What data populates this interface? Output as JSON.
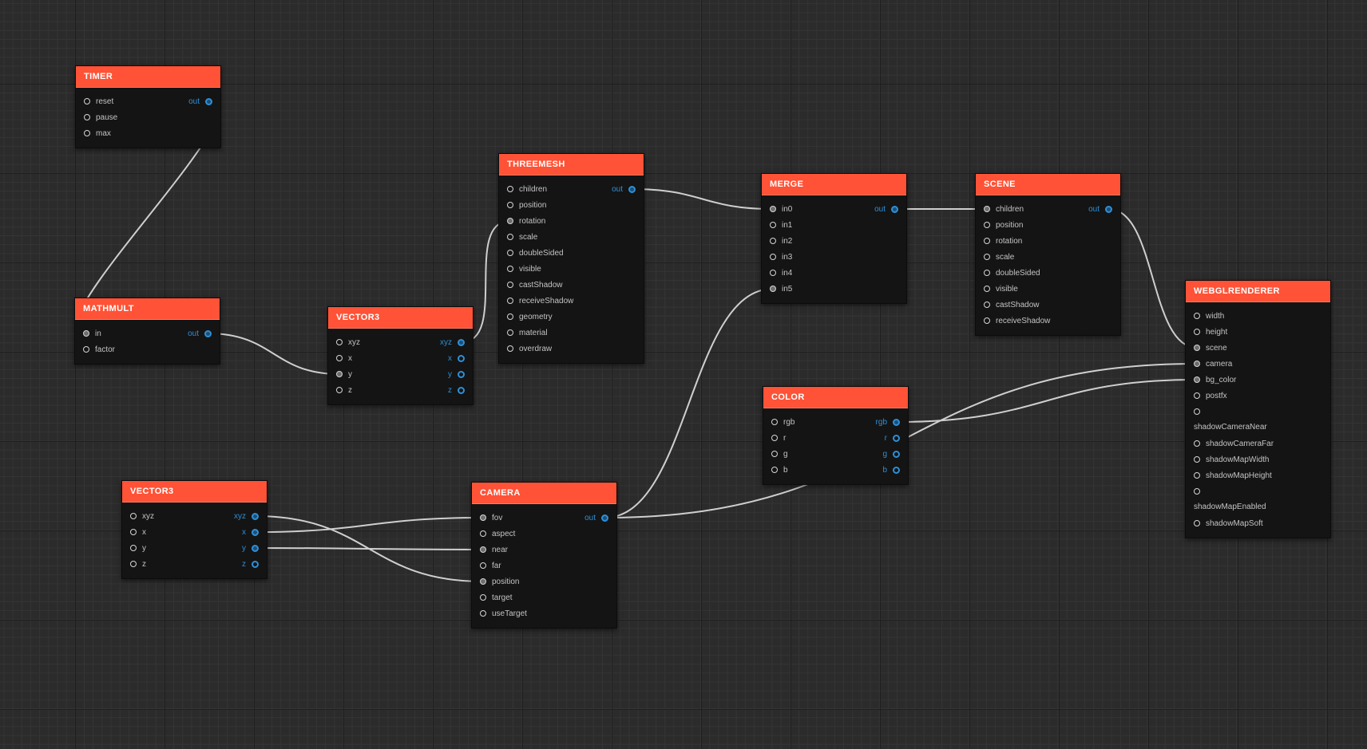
{
  "nodes": {
    "timer": {
      "title": "TIMER",
      "inputs": [
        "reset",
        "pause",
        "max"
      ],
      "outputs": [
        "out"
      ]
    },
    "mathmult": {
      "title": "MATHMULT",
      "inputs": [
        "in",
        "factor"
      ],
      "outputs": [
        "out"
      ]
    },
    "vector3_a": {
      "title": "VECTOR3",
      "inputs": [
        "xyz",
        "x",
        "y",
        "z"
      ],
      "outputs": [
        "xyz",
        "x",
        "y",
        "z"
      ]
    },
    "threemesh": {
      "title": "THREEMESH",
      "inputs": [
        "children",
        "position",
        "rotation",
        "scale",
        "doubleSided",
        "visible",
        "castShadow",
        "receiveShadow",
        "geometry",
        "material",
        "overdraw"
      ],
      "outputs": [
        "out"
      ]
    },
    "merge": {
      "title": "MERGE",
      "inputs": [
        "in0",
        "in1",
        "in2",
        "in3",
        "in4",
        "in5"
      ],
      "outputs": [
        "out"
      ]
    },
    "scene": {
      "title": "SCENE",
      "inputs": [
        "children",
        "position",
        "rotation",
        "scale",
        "doubleSided",
        "visible",
        "castShadow",
        "receiveShadow"
      ],
      "outputs": [
        "out"
      ]
    },
    "webglrenderer": {
      "title": "WEBGLRENDERER",
      "inputs": [
        "width",
        "height",
        "scene",
        "camera",
        "bg_color",
        "postfx",
        "",
        "shadowCameraFar",
        "shadowMapWidth",
        "shadowMapHeight",
        "",
        "shadowMapSoft"
      ],
      "text_rows": [
        "shadowCameraNear",
        "shadowMapEnabled"
      ]
    },
    "color": {
      "title": "COLOR",
      "inputs": [
        "rgb",
        "r",
        "g",
        "b"
      ],
      "outputs": [
        "rgb",
        "r",
        "g",
        "b"
      ]
    },
    "vector3_b": {
      "title": "VECTOR3",
      "inputs": [
        "xyz",
        "x",
        "y",
        "z"
      ],
      "outputs": [
        "xyz",
        "x",
        "y",
        "z"
      ]
    },
    "camera": {
      "title": "CAMERA",
      "inputs": [
        "fov",
        "aspect",
        "near",
        "far",
        "position",
        "target",
        "useTarget"
      ],
      "outputs": [
        "out"
      ]
    }
  },
  "connections": [
    {
      "from": "timer.out",
      "to": "mathmult.in"
    },
    {
      "from": "mathmult.out",
      "to": "vector3_a.y"
    },
    {
      "from": "vector3_a.xyz",
      "to": "threemesh.rotation"
    },
    {
      "from": "threemesh.out",
      "to": "merge.in0"
    },
    {
      "from": "merge.out",
      "to": "scene.children"
    },
    {
      "from": "scene.out",
      "to": "webglrenderer.scene"
    },
    {
      "from": "camera.out",
      "to": "merge.in5"
    },
    {
      "from": "camera.out",
      "to": "webglrenderer.camera"
    },
    {
      "from": "color.rgb",
      "to": "webglrenderer.bg_color"
    },
    {
      "from": "vector3_b.xyz",
      "to": "camera.position"
    },
    {
      "from": "vector3_b.x",
      "to": "camera.fov"
    },
    {
      "from": "vector3_b.y",
      "to": "camera.near"
    }
  ],
  "colors": {
    "canvas_bg": "#2b2b2b",
    "node_header": "#ff5236",
    "node_body": "#141414",
    "output_accent": "#2e8fd6",
    "wire": "#cfcfcf"
  }
}
